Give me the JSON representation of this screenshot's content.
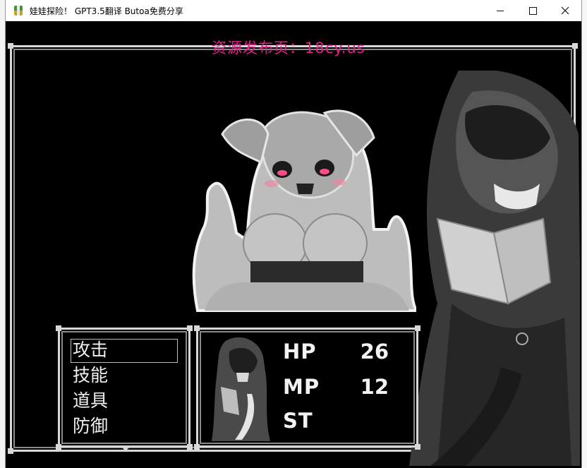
{
  "window": {
    "title": "娃娃探险！ GPT3.5翻译 Butoa免费分享",
    "minimize_label": "—",
    "maximize_label": "☐",
    "close_label": "✕"
  },
  "game": {
    "watermark": "资源发布页：18cy.us"
  },
  "command_menu": {
    "items": [
      {
        "label": "攻击"
      },
      {
        "label": "技能"
      },
      {
        "label": "道具"
      },
      {
        "label": "防御"
      }
    ],
    "selected_index": 0
  },
  "status": {
    "hp_label": "HP",
    "hp_value": "26",
    "mp_label": "MP",
    "mp_value": "12",
    "st_label": "ST",
    "st_value": ""
  },
  "colors": {
    "watermark": "#e0218a",
    "frame": "#d8d8d8",
    "text": "#f0f0f0"
  }
}
